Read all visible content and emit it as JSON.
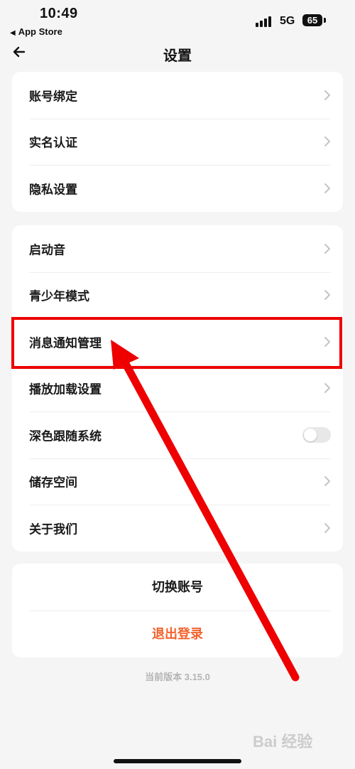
{
  "status_bar": {
    "time": "10:49",
    "back_app": "App Store",
    "network": "5G",
    "battery": "65"
  },
  "header": {
    "title": "设置",
    "back_icon": "arrow-left-icon"
  },
  "group1": {
    "items": [
      {
        "label": "账号绑定"
      },
      {
        "label": "实名认证"
      },
      {
        "label": "隐私设置"
      }
    ]
  },
  "group2": {
    "items": [
      {
        "label": "启动音"
      },
      {
        "label": "青少年模式"
      },
      {
        "label": "消息通知管理"
      },
      {
        "label": "播放加载设置"
      },
      {
        "label": "深色跟随系统",
        "toggle": false
      },
      {
        "label": "储存空间"
      },
      {
        "label": "关于我们"
      }
    ]
  },
  "actions": {
    "switch_account": "切换账号",
    "logout": "退出登录"
  },
  "footer": {
    "version": "当前版本 3.15.0"
  },
  "watermark": "Bai 经验",
  "colors": {
    "background": "#f5f5f5",
    "logout": "#f2632e",
    "annotation": "#ee0000",
    "chevron": "#c4c4c4"
  }
}
